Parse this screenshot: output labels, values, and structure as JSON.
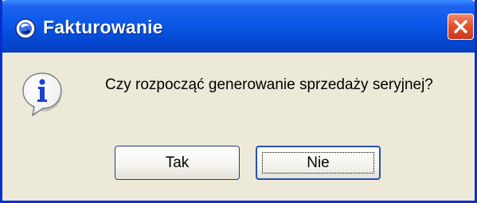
{
  "window": {
    "title": "Fakturowanie",
    "app_icon": "app-logo-icon",
    "close_icon": "close-icon"
  },
  "dialog": {
    "icon": "information-icon",
    "message": "Czy rozpocząć generowanie sprzedaży seryjnej?",
    "buttons": {
      "yes_label": "Tak",
      "no_label": "Nie"
    },
    "focused_button": "Nie"
  },
  "colors": {
    "titlebar": "#0a58e8",
    "client_bg": "#ece9d8",
    "close_button": "#e3522e",
    "info_icon": "#1d3fd6"
  }
}
